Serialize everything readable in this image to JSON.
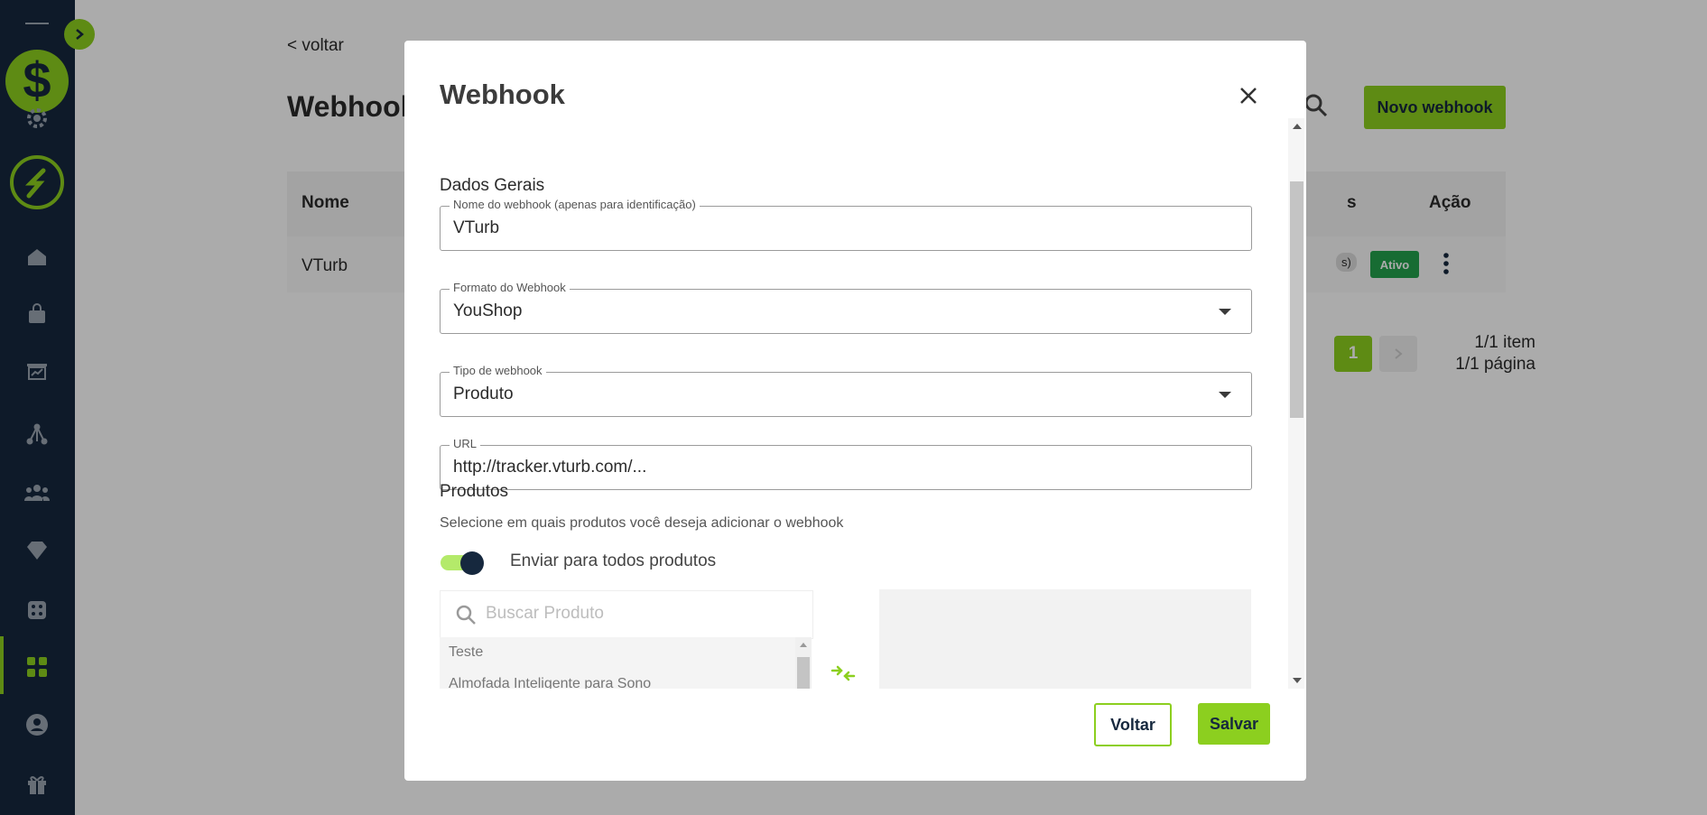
{
  "colors": {
    "accent": "#8ccf1f",
    "sidebar": "#16283e",
    "active_badge": "#23a24d"
  },
  "sidebar": {
    "icons": [
      "menu-line-icon",
      "dollar-logo-icon",
      "settings-icon",
      "brand-logo-icon",
      "home-icon",
      "shopping-bag-icon",
      "presentation-chart-icon",
      "network-icon",
      "users-icon",
      "diamond-icon",
      "dice-icon",
      "apps-grid-icon",
      "user-circle-icon",
      "gift-icon"
    ]
  },
  "page": {
    "back_link": "< voltar",
    "title": "Webhook",
    "new_button": "Novo webhook",
    "table": {
      "headers": {
        "nome": "Nome",
        "status_fragment": "s",
        "acao": "Ação"
      },
      "rows": [
        {
          "nome": "VTurb",
          "pill": "s)",
          "status": "Ativo"
        }
      ]
    },
    "pagination": {
      "current": "1",
      "items": "1/1 item",
      "pages": "1/1 página"
    }
  },
  "modal": {
    "title": "Webhook",
    "section_general": "Dados Gerais",
    "fields": {
      "name": {
        "label": "Nome do webhook (apenas para identificação)",
        "value": "VTurb"
      },
      "format": {
        "label": "Formato do Webhook",
        "value": "YouShop"
      },
      "type": {
        "label": "Tipo de webhook",
        "value": "Produto"
      },
      "url": {
        "label": "URL",
        "value": "http://tracker.vturb.com/..."
      }
    },
    "section_products": "Produtos",
    "products_help": "Selecione em quais produtos você deseja adicionar o webhook",
    "toggle_all": {
      "label": "Enviar para todos produtos",
      "on": true
    },
    "search": {
      "placeholder": "Buscar Produto"
    },
    "product_list": [
      "Teste",
      "Almofada Inteligente para Sono"
    ],
    "buttons": {
      "back": "Voltar",
      "save": "Salvar"
    }
  }
}
